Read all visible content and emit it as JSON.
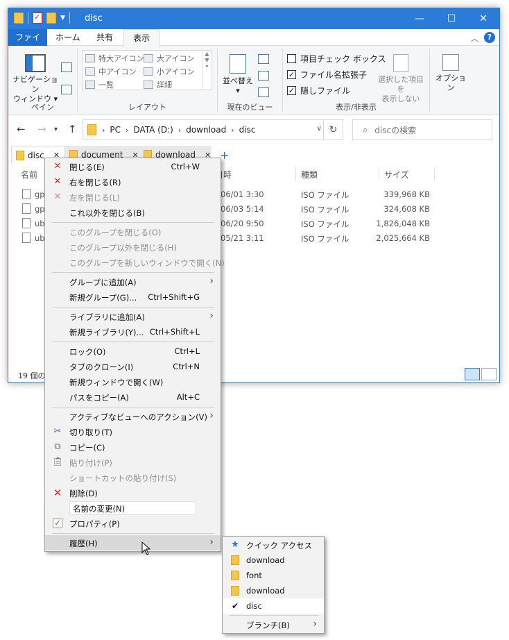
{
  "window": {
    "title": "disc"
  },
  "titlebar": {
    "minimize": "—",
    "maximize": "☐",
    "close": "✕"
  },
  "ribbon_tabs": {
    "file": "ファイル",
    "home": "ホーム",
    "share": "共有",
    "view": "表示"
  },
  "ribbon": {
    "pane": {
      "nav_pane_line1": "ナビゲーション",
      "nav_pane_line2": "ウィンドウ",
      "label": "ペイン"
    },
    "layout": {
      "items": [
        "特大アイコン",
        "大アイコン",
        "中アイコン",
        "小アイコン",
        "一覧",
        "詳細"
      ],
      "label": "レイアウト"
    },
    "current_view": {
      "sort": "並べ替え",
      "label": "現在のビュー"
    },
    "show_hide": {
      "item_checkbox": "項目チェック ボックス",
      "file_ext": "ファイル名拡張子",
      "hidden": "隠しファイル",
      "hide_selected_line1": "選択した項目を",
      "hide_selected_line2": "表示しない",
      "label": "表示/非表示"
    },
    "options": "オプション"
  },
  "address": {
    "crumbs": [
      "PC",
      "DATA (D:)",
      "download",
      "disc"
    ],
    "search_placeholder": "discの検索"
  },
  "folder_tabs": [
    {
      "label": "disc"
    },
    {
      "label": "document"
    },
    {
      "label": "download"
    }
  ],
  "columns": {
    "name": "名前",
    "date": "日時",
    "type": "種類",
    "size": "サイズ"
  },
  "files": [
    {
      "name": "gp",
      "date": "06/01 3:30",
      "type": "ISO ファイル",
      "size": "339,968 KB"
    },
    {
      "name": "gp",
      "date": "06/03 5:14",
      "type": "ISO ファイル",
      "size": "324,608 KB"
    },
    {
      "name": "ub",
      "date": "06/20 9:50",
      "type": "ISO ファイル",
      "size": "1,826,048 KB"
    },
    {
      "name": "ub",
      "date": "05/21 3:11",
      "type": "ISO ファイル",
      "size": "2,025,664 KB"
    }
  ],
  "status": {
    "count": "19 個の"
  },
  "context_menu": {
    "close": {
      "label": "閉じる(E)",
      "shortcut": "Ctrl+W"
    },
    "close_right": {
      "label": "右を閉じる(R)"
    },
    "close_left": {
      "label": "左を閉じる(L)"
    },
    "close_others": {
      "label": "これ以外を閉じる(B)"
    },
    "close_group": {
      "label": "このグループを閉じる(O)"
    },
    "close_other_groups": {
      "label": "このグループ以外を閉じる(H)"
    },
    "open_group_new_window": {
      "label": "このグループを新しいウィンドウで開く(N)"
    },
    "add_to_group": {
      "label": "グループに追加(A)"
    },
    "new_group": {
      "label": "新規グループ(G)...",
      "shortcut": "Ctrl+Shift+G"
    },
    "add_to_library": {
      "label": "ライブラリに追加(A)"
    },
    "new_library": {
      "label": "新規ライブラリ(Y)...",
      "shortcut": "Ctrl+Shift+L"
    },
    "lock": {
      "label": "ロック(O)",
      "shortcut": "Ctrl+L"
    },
    "clone_tab": {
      "label": "タブのクローン(I)",
      "shortcut": "Ctrl+N"
    },
    "open_new_window": {
      "label": "新規ウィンドウで開く(W)"
    },
    "copy_path": {
      "label": "パスをコピー(A)",
      "shortcut": "Alt+C"
    },
    "action_active_view": {
      "label": "アクティブなビューへのアクション(V)"
    },
    "cut": {
      "label": "切り取り(T)"
    },
    "copy": {
      "label": "コピー(C)"
    },
    "paste": {
      "label": "貼り付け(P)"
    },
    "paste_shortcut": {
      "label": "ショートカットの貼り付け(S)"
    },
    "delete": {
      "label": "削除(D)"
    },
    "rename": {
      "label": "名前の変更(N)"
    },
    "properties": {
      "label": "プロパティ(P)"
    },
    "history": {
      "label": "履歴(H)"
    }
  },
  "history_submenu": {
    "items": [
      "クイック アクセス",
      "download",
      "font",
      "download",
      "disc"
    ],
    "branch": "ブランチ(B)"
  }
}
